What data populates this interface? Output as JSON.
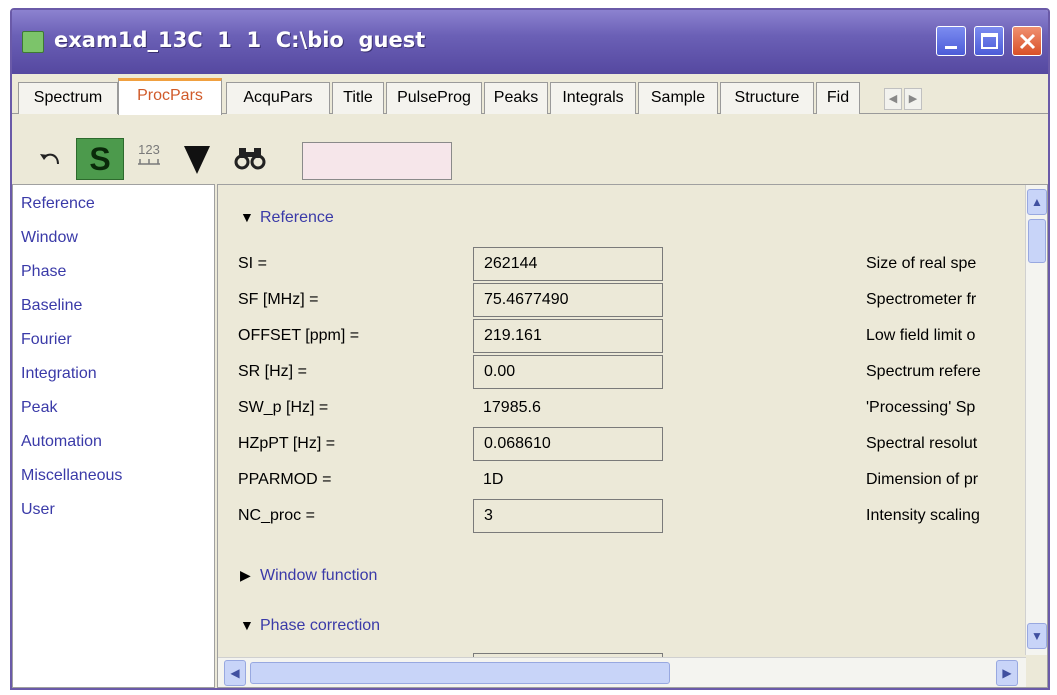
{
  "window": {
    "title": "exam1d_13C  1  1  C:\\bio  guest"
  },
  "tabs": [
    {
      "label": "Spectrum",
      "active": false
    },
    {
      "label": "ProcPars",
      "active": true
    },
    {
      "label": "AcquPars",
      "active": false
    },
    {
      "label": "Title",
      "active": false
    },
    {
      "label": "PulseProg",
      "active": false
    },
    {
      "label": "Peaks",
      "active": false
    },
    {
      "label": "Integrals",
      "active": false
    },
    {
      "label": "Sample",
      "active": false
    },
    {
      "label": "Structure",
      "active": false
    },
    {
      "label": "Fid",
      "active": false
    }
  ],
  "toolbar": {
    "s_label": "S",
    "numeric_label": "123",
    "search_value": ""
  },
  "sidebar": {
    "items": [
      "Reference",
      "Window",
      "Phase",
      "Baseline",
      "Fourier",
      "Integration",
      "Peak",
      "Automation",
      "Miscellaneous",
      "User"
    ]
  },
  "sections": {
    "reference": "Reference",
    "window_function": "Window function",
    "phase_correction": "Phase correction"
  },
  "params": [
    {
      "label": "SI =",
      "value": "262144",
      "editable": true,
      "desc": "Size of real spe"
    },
    {
      "label": "SF [MHz] =",
      "value": "75.4677490",
      "editable": true,
      "desc": "Spectrometer fr"
    },
    {
      "label": "OFFSET [ppm] =",
      "value": "219.161",
      "editable": true,
      "desc": "Low field limit o"
    },
    {
      "label": "SR [Hz] =",
      "value": "0.00",
      "editable": true,
      "desc": "Spectrum refere"
    },
    {
      "label": "SW_p [Hz] =",
      "value": "17985.6",
      "editable": false,
      "desc": "'Processing' Sp"
    },
    {
      "label": "HZpPT [Hz] =",
      "value": "0.068610",
      "editable": true,
      "desc": "Spectral resolut"
    },
    {
      "label": "PPARMOD =",
      "value": "1D",
      "editable": false,
      "desc": "Dimension of pr"
    },
    {
      "label": "NC_proc =",
      "value": "3",
      "editable": true,
      "desc": "Intensity scaling"
    }
  ],
  "colors": {
    "title_bar": "#6b60b6",
    "active_tab": "#d05a2a",
    "link_blue": "#3a3aa8",
    "s_button": "#4c9a4c"
  }
}
